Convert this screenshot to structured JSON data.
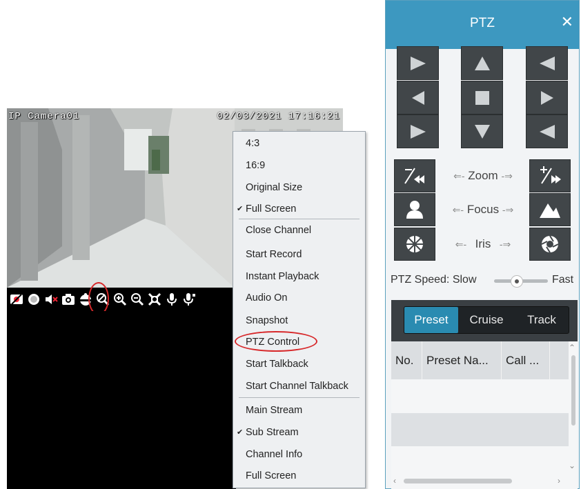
{
  "camera": {
    "name": "IP Camera01",
    "timestamp": "02/03/2021 17:16:21"
  },
  "toolbar": {
    "icons": [
      "record-off-icon",
      "record-icon",
      "mute-icon",
      "snapshot-icon",
      "ptz-icon",
      "zoom-off-icon",
      "zoom-in-icon",
      "zoom-out-icon",
      "fit-icon",
      "microphone-icon",
      "channel-talkback-icon"
    ]
  },
  "context_menu": {
    "items": [
      {
        "label": "4:3",
        "checked": false
      },
      {
        "label": "16:9",
        "checked": false
      },
      {
        "label": "Original Size",
        "checked": false
      },
      {
        "label": "Full Screen",
        "checked": true
      },
      {
        "label": "Close Channel",
        "checked": false
      },
      {
        "label": "Start Record",
        "checked": false
      },
      {
        "label": "Instant Playback",
        "checked": false
      },
      {
        "label": "Audio On",
        "checked": false
      },
      {
        "label": "Snapshot",
        "checked": false
      },
      {
        "label": "PTZ Control",
        "checked": false
      },
      {
        "label": "Start Talkback",
        "checked": false
      },
      {
        "label": "Start Channel Talkback",
        "checked": false
      },
      {
        "label": "Main Stream",
        "checked": false
      },
      {
        "label": "Sub Stream",
        "checked": true
      },
      {
        "label": "Channel Info",
        "checked": false
      },
      {
        "label": "Full Screen",
        "checked": false
      }
    ],
    "check_mark": "✔"
  },
  "ptz": {
    "title": "PTZ",
    "close": "✕",
    "zoom_label": "Zoom",
    "focus_label": "Focus",
    "iris_label": "Iris",
    "speed_label": "PTZ Speed: Slow",
    "speed_fast": "Fast",
    "speed_value": 0.5,
    "tabs": [
      "Preset",
      "Cruise",
      "Track"
    ],
    "active_tab": "Preset",
    "columns": [
      "No.",
      "Preset Na...",
      "Call ..."
    ]
  },
  "colors": {
    "header": "#3d98c0",
    "active_tab": "#2a8bb1",
    "highlight": "#d7282a",
    "button": "#414649"
  }
}
